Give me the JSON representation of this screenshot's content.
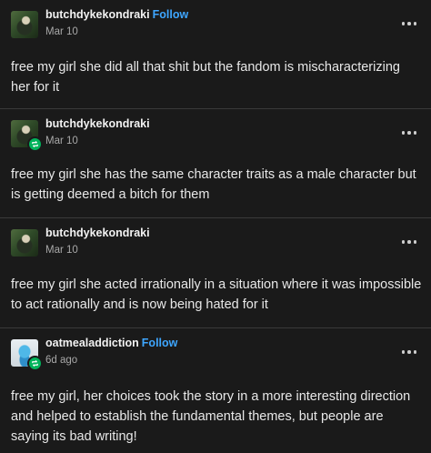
{
  "posts": [
    {
      "username": "butchdykekondraki",
      "follow": "Follow",
      "date": "Mar 10",
      "text": "free my girl she did all that shit but the fandom is mischaracterizing her for it",
      "reblog": false,
      "avatar_icon": "green-character-avatar"
    },
    {
      "username": "butchdykekondraki",
      "follow": "",
      "date": "Mar 10",
      "text": "free my girl she has the same character traits as a male character but is getting deemed a bitch for them",
      "reblog": true,
      "avatar_icon": "green-character-avatar"
    },
    {
      "username": "butchdykekondraki",
      "follow": "",
      "date": "Mar 10",
      "text": "free my girl she acted irrationally in a situation where it was impossible to act rationally and is now being hated for it",
      "reblog": false,
      "avatar_icon": "green-character-avatar"
    },
    {
      "username": "oatmealaddiction",
      "follow": "Follow",
      "date": "6d ago",
      "text": "free my girl, her choices took the story in a more interesting direction and helped to establish the fundamental themes, but people are saying its bad writing!",
      "reblog": true,
      "avatar_icon": "blue-figure-avatar"
    }
  ],
  "colors": {
    "background": "#1a1a1a",
    "follow": "#3ea6ff",
    "reblog_badge": "#00b35b",
    "divider": "#3a3a3a"
  },
  "icons": {
    "more": "more-options-icon",
    "reblog": "reblog-icon"
  }
}
